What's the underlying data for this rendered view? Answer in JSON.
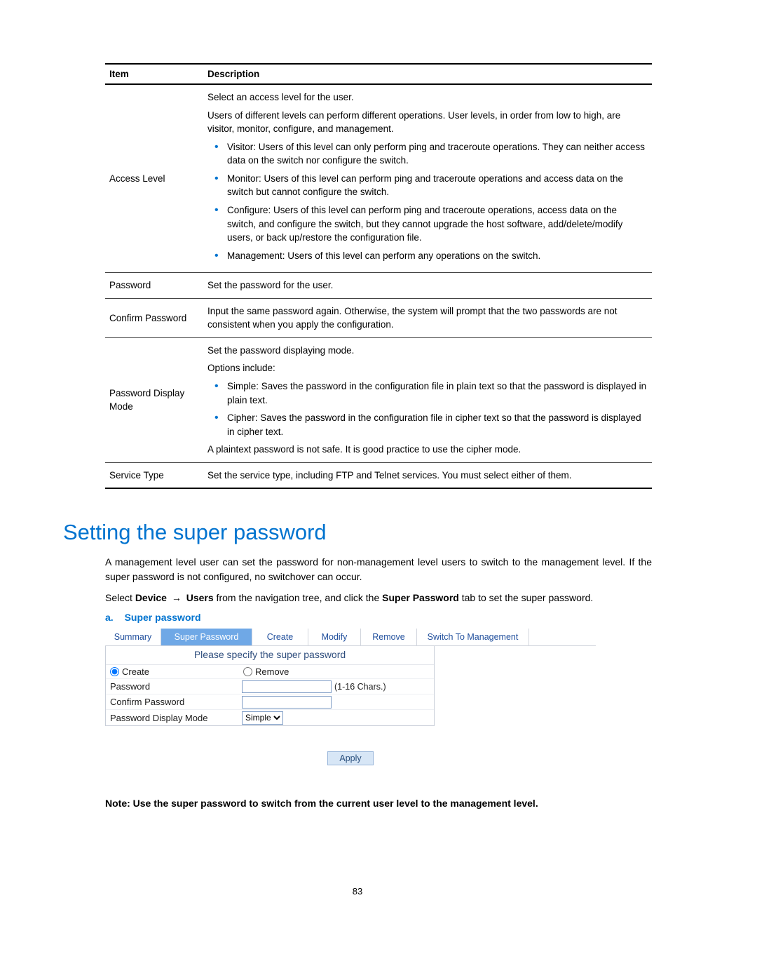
{
  "table": {
    "headers": {
      "item": "Item",
      "desc": "Description"
    },
    "rows": {
      "access_level": {
        "item": "Access Level",
        "p1": "Select an access level for the user.",
        "p2": "Users of different levels can perform different operations. User levels, in order from low to high, are visitor, monitor, configure, and management.",
        "b1": "Visitor: Users of this level can only perform ping and traceroute operations. They can neither access data on the switch nor configure the switch.",
        "b2": "Monitor: Users of this level can perform ping and traceroute operations and access data on the switch but cannot configure the switch.",
        "b3": "Configure: Users of this level can perform ping and traceroute operations, access data on the switch, and configure the switch, but they cannot upgrade the host software, add/delete/modify users, or back up/restore the configuration file.",
        "b4": "Management: Users of this level can perform any operations on the switch."
      },
      "password": {
        "item": "Password",
        "p1": "Set the password for the user."
      },
      "confirm_password": {
        "item": "Confirm Password",
        "p1": "Input the same password again. Otherwise, the system will prompt that the two passwords are not consistent when you apply the configuration."
      },
      "pdm": {
        "item": "Password Display Mode",
        "p1": "Set the password displaying mode.",
        "p2": "Options include:",
        "b1": "Simple: Saves the password in the configuration file in plain text so that the password is displayed in plain text.",
        "b2": "Cipher: Saves the password in the configuration file in cipher text so that the password is displayed in cipher text.",
        "p3": "A plaintext password is not safe. It is good practice to use the cipher mode."
      },
      "service_type": {
        "item": "Service Type",
        "p1": "Set the service type, including FTP and Telnet services. You must select either of them."
      }
    }
  },
  "section": {
    "title": "Setting the super password",
    "para1": "A management level user can set the password for non-management level users to switch to the management level. If the super password is not configured, no switchover can occur.",
    "para2_pre": "Select ",
    "para2_device": "Device",
    "para2_arrow": "→",
    "para2_users": "Users",
    "para2_mid": " from the navigation tree, and click the ",
    "para2_sp": "Super Password",
    "para2_post": " tab to set the super password."
  },
  "caption": {
    "label": "a.",
    "title": "Super password"
  },
  "sp": {
    "tabs": {
      "summary": "Summary",
      "super": "Super Password",
      "create": "Create",
      "modify": "Modify",
      "remove": "Remove",
      "switch": "Switch To Management"
    },
    "title": "Please specify the super password",
    "radio_create": "Create",
    "radio_remove": "Remove",
    "lbl_password": "Password",
    "hint_password": "(1-16 Chars.)",
    "lbl_confirm": "Confirm Password",
    "lbl_pdm": "Password Display Mode",
    "sel_pdm": "Simple",
    "apply": "Apply"
  },
  "note": "Note: Use the super password to switch from the current user level to the management level.",
  "page": "83"
}
